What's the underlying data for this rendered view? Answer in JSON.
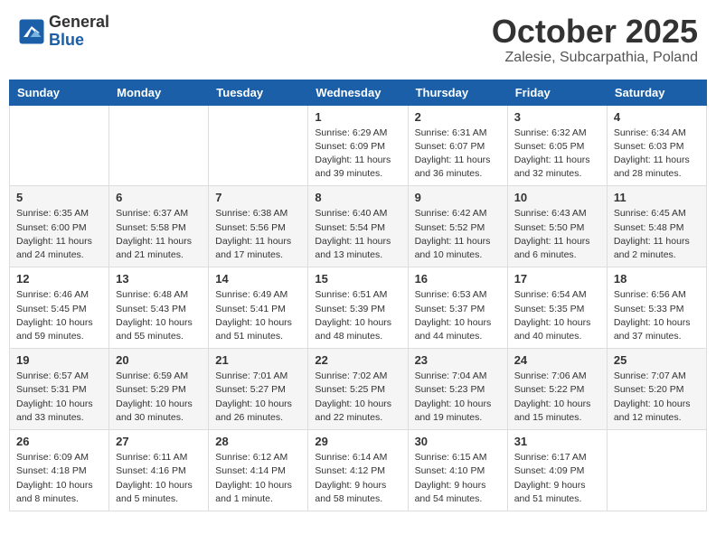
{
  "header": {
    "logo_general": "General",
    "logo_blue": "Blue",
    "month_title": "October 2025",
    "location": "Zalesie, Subcarpathia, Poland"
  },
  "days_of_week": [
    "Sunday",
    "Monday",
    "Tuesday",
    "Wednesday",
    "Thursday",
    "Friday",
    "Saturday"
  ],
  "weeks": [
    [
      {
        "day": "",
        "info": ""
      },
      {
        "day": "",
        "info": ""
      },
      {
        "day": "",
        "info": ""
      },
      {
        "day": "1",
        "info": "Sunrise: 6:29 AM\nSunset: 6:09 PM\nDaylight: 11 hours\nand 39 minutes."
      },
      {
        "day": "2",
        "info": "Sunrise: 6:31 AM\nSunset: 6:07 PM\nDaylight: 11 hours\nand 36 minutes."
      },
      {
        "day": "3",
        "info": "Sunrise: 6:32 AM\nSunset: 6:05 PM\nDaylight: 11 hours\nand 32 minutes."
      },
      {
        "day": "4",
        "info": "Sunrise: 6:34 AM\nSunset: 6:03 PM\nDaylight: 11 hours\nand 28 minutes."
      }
    ],
    [
      {
        "day": "5",
        "info": "Sunrise: 6:35 AM\nSunset: 6:00 PM\nDaylight: 11 hours\nand 24 minutes."
      },
      {
        "day": "6",
        "info": "Sunrise: 6:37 AM\nSunset: 5:58 PM\nDaylight: 11 hours\nand 21 minutes."
      },
      {
        "day": "7",
        "info": "Sunrise: 6:38 AM\nSunset: 5:56 PM\nDaylight: 11 hours\nand 17 minutes."
      },
      {
        "day": "8",
        "info": "Sunrise: 6:40 AM\nSunset: 5:54 PM\nDaylight: 11 hours\nand 13 minutes."
      },
      {
        "day": "9",
        "info": "Sunrise: 6:42 AM\nSunset: 5:52 PM\nDaylight: 11 hours\nand 10 minutes."
      },
      {
        "day": "10",
        "info": "Sunrise: 6:43 AM\nSunset: 5:50 PM\nDaylight: 11 hours\nand 6 minutes."
      },
      {
        "day": "11",
        "info": "Sunrise: 6:45 AM\nSunset: 5:48 PM\nDaylight: 11 hours\nand 2 minutes."
      }
    ],
    [
      {
        "day": "12",
        "info": "Sunrise: 6:46 AM\nSunset: 5:45 PM\nDaylight: 10 hours\nand 59 minutes."
      },
      {
        "day": "13",
        "info": "Sunrise: 6:48 AM\nSunset: 5:43 PM\nDaylight: 10 hours\nand 55 minutes."
      },
      {
        "day": "14",
        "info": "Sunrise: 6:49 AM\nSunset: 5:41 PM\nDaylight: 10 hours\nand 51 minutes."
      },
      {
        "day": "15",
        "info": "Sunrise: 6:51 AM\nSunset: 5:39 PM\nDaylight: 10 hours\nand 48 minutes."
      },
      {
        "day": "16",
        "info": "Sunrise: 6:53 AM\nSunset: 5:37 PM\nDaylight: 10 hours\nand 44 minutes."
      },
      {
        "day": "17",
        "info": "Sunrise: 6:54 AM\nSunset: 5:35 PM\nDaylight: 10 hours\nand 40 minutes."
      },
      {
        "day": "18",
        "info": "Sunrise: 6:56 AM\nSunset: 5:33 PM\nDaylight: 10 hours\nand 37 minutes."
      }
    ],
    [
      {
        "day": "19",
        "info": "Sunrise: 6:57 AM\nSunset: 5:31 PM\nDaylight: 10 hours\nand 33 minutes."
      },
      {
        "day": "20",
        "info": "Sunrise: 6:59 AM\nSunset: 5:29 PM\nDaylight: 10 hours\nand 30 minutes."
      },
      {
        "day": "21",
        "info": "Sunrise: 7:01 AM\nSunset: 5:27 PM\nDaylight: 10 hours\nand 26 minutes."
      },
      {
        "day": "22",
        "info": "Sunrise: 7:02 AM\nSunset: 5:25 PM\nDaylight: 10 hours\nand 22 minutes."
      },
      {
        "day": "23",
        "info": "Sunrise: 7:04 AM\nSunset: 5:23 PM\nDaylight: 10 hours\nand 19 minutes."
      },
      {
        "day": "24",
        "info": "Sunrise: 7:06 AM\nSunset: 5:22 PM\nDaylight: 10 hours\nand 15 minutes."
      },
      {
        "day": "25",
        "info": "Sunrise: 7:07 AM\nSunset: 5:20 PM\nDaylight: 10 hours\nand 12 minutes."
      }
    ],
    [
      {
        "day": "26",
        "info": "Sunrise: 6:09 AM\nSunset: 4:18 PM\nDaylight: 10 hours\nand 8 minutes."
      },
      {
        "day": "27",
        "info": "Sunrise: 6:11 AM\nSunset: 4:16 PM\nDaylight: 10 hours\nand 5 minutes."
      },
      {
        "day": "28",
        "info": "Sunrise: 6:12 AM\nSunset: 4:14 PM\nDaylight: 10 hours\nand 1 minute."
      },
      {
        "day": "29",
        "info": "Sunrise: 6:14 AM\nSunset: 4:12 PM\nDaylight: 9 hours\nand 58 minutes."
      },
      {
        "day": "30",
        "info": "Sunrise: 6:15 AM\nSunset: 4:10 PM\nDaylight: 9 hours\nand 54 minutes."
      },
      {
        "day": "31",
        "info": "Sunrise: 6:17 AM\nSunset: 4:09 PM\nDaylight: 9 hours\nand 51 minutes."
      },
      {
        "day": "",
        "info": ""
      }
    ]
  ]
}
